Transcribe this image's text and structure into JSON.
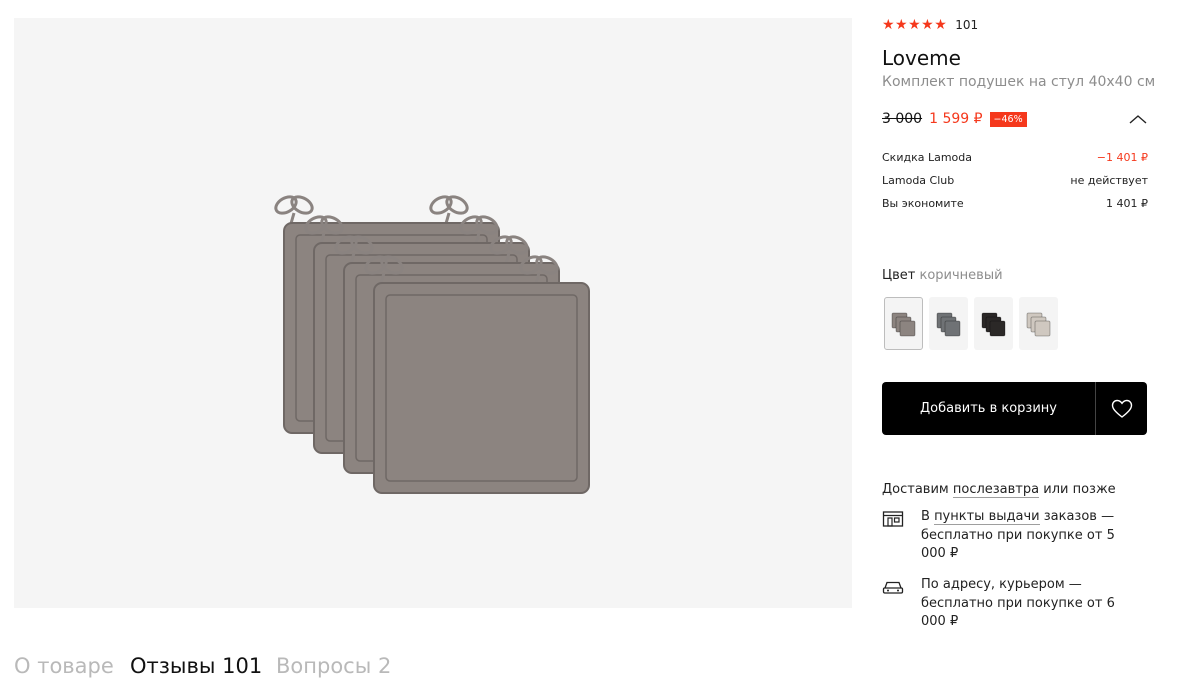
{
  "product": {
    "rating_stars": "★★★★★",
    "rating_count": "101",
    "brand": "Loveme",
    "title": "Комплект подушек на стул 40х40 см"
  },
  "price": {
    "old": "3 000",
    "new": "1 599 ₽",
    "discount": "−46%"
  },
  "breakdown": [
    {
      "label": "Скидка Lamoda",
      "value": "−1 401 ₽"
    },
    {
      "label": "Lamoda Club",
      "value": "не действует"
    },
    {
      "label": "Вы экономите",
      "value": "1 401 ₽"
    }
  ],
  "color": {
    "label": "Цвет",
    "value": "коричневый",
    "swatches": [
      "#8c8480",
      "#6f7275",
      "#2b2827",
      "#cfc8c0"
    ]
  },
  "actions": {
    "add_to_cart": "Добавить в корзину",
    "favorite_icon": "heart-icon"
  },
  "delivery": {
    "prefix": "Доставим",
    "date_link": "послезавтра",
    "suffix": "или позже",
    "options": [
      {
        "icon": "pickup-point-icon",
        "pre": "В",
        "link": "пункты выдачи",
        "rest": "заказов — бесплатно при покупке от 5 000 ₽"
      },
      {
        "icon": "car-icon",
        "pre": "",
        "link": "",
        "rest": "По адресу, курьером — бесплатно при покупке от 6 000 ₽"
      }
    ]
  },
  "tabs": [
    {
      "label": "О товаре",
      "active": false
    },
    {
      "label": "Отзывы 101",
      "active": true
    },
    {
      "label": "Вопросы 2",
      "active": false
    }
  ],
  "colors": {
    "accent": "#f5381c",
    "button": "#000000",
    "muted": "#8d8d8d"
  }
}
